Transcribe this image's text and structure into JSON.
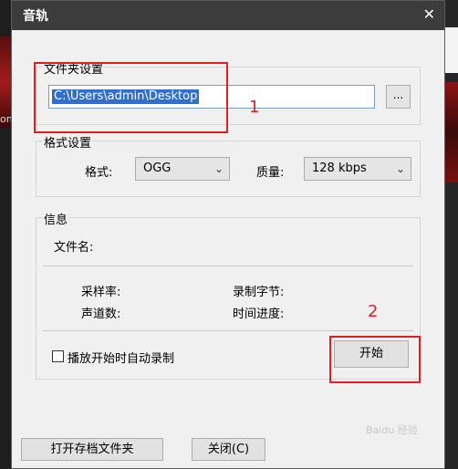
{
  "window": {
    "title": "音轨"
  },
  "folder_group": {
    "legend": "文件夹设置",
    "path_value": "C:\\Users\\admin\\Desktop",
    "browse_label": "..."
  },
  "format_group": {
    "legend": "格式设置",
    "format_label": "格式:",
    "format_value": "OGG",
    "quality_label": "质量:",
    "quality_value": "128 kbps"
  },
  "info_group": {
    "legend": "信息",
    "filename_label": "文件名:",
    "samplerate_label": "采样率:",
    "bytes_label": "录制字节:",
    "channels_label": "声道数:",
    "progress_label": "时间进度:",
    "autorecord_label": "播放开始时自动录制",
    "start_label": "开始"
  },
  "footer": {
    "open_folder_label": "打开存档文件夹",
    "close_label": "关闭(C)"
  },
  "annotations": {
    "one": "1",
    "two": "2"
  },
  "background": {
    "left_text": "on"
  },
  "watermark": "Baidu 经验"
}
